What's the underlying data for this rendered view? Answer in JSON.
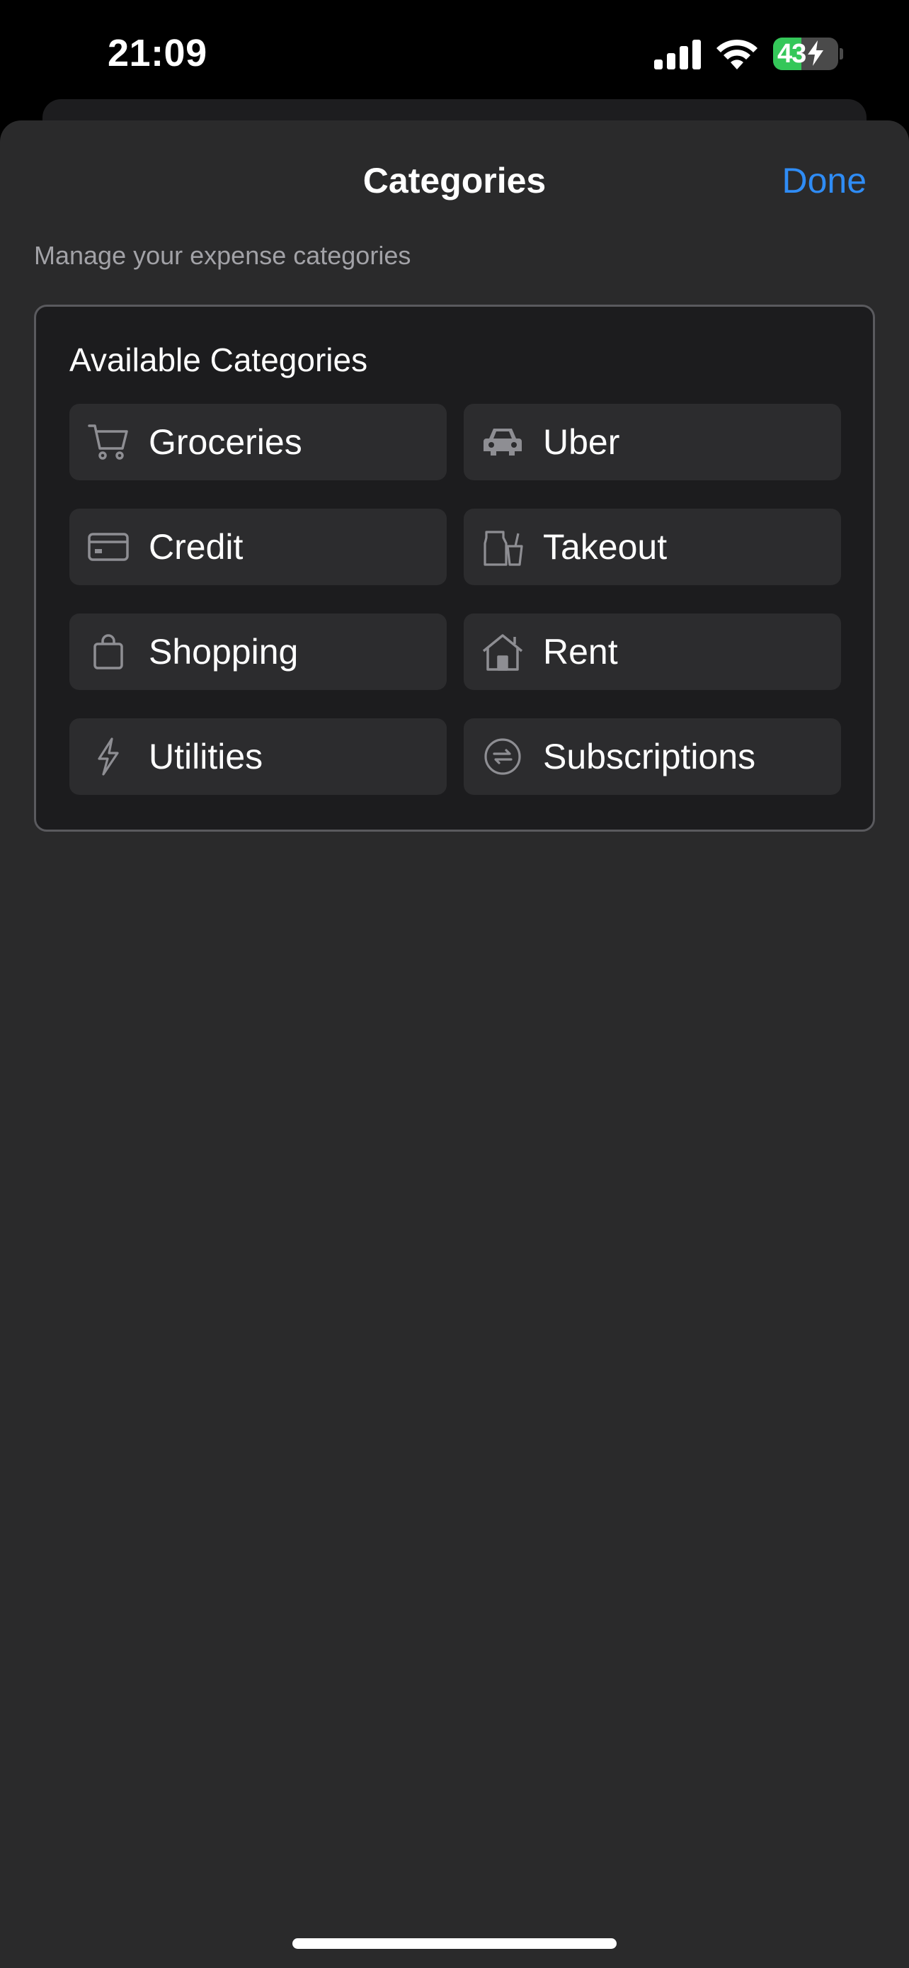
{
  "status_bar": {
    "time": "21:09",
    "battery_percent": "43",
    "battery_level": 0.43,
    "battery_color": "#34c759",
    "signal_icon": "cellular-signal-icon",
    "wifi_icon": "wifi-icon",
    "charging_icon": "bolt-icon"
  },
  "sheet": {
    "title": "Categories",
    "done_label": "Done",
    "subtitle": "Manage your expense categories",
    "accent_color": "#2f8cf5"
  },
  "card": {
    "title": "Available Categories",
    "categories": [
      {
        "label": "Groceries",
        "icon": "cart-icon"
      },
      {
        "label": "Uber",
        "icon": "car-icon"
      },
      {
        "label": "Credit",
        "icon": "credit-card-icon"
      },
      {
        "label": "Takeout",
        "icon": "takeout-cup-icon"
      },
      {
        "label": "Shopping",
        "icon": "shopping-bag-icon"
      },
      {
        "label": "Rent",
        "icon": "house-icon"
      },
      {
        "label": "Utilities",
        "icon": "bolt-icon"
      },
      {
        "label": "Subscriptions",
        "icon": "recurring-icon"
      }
    ]
  }
}
